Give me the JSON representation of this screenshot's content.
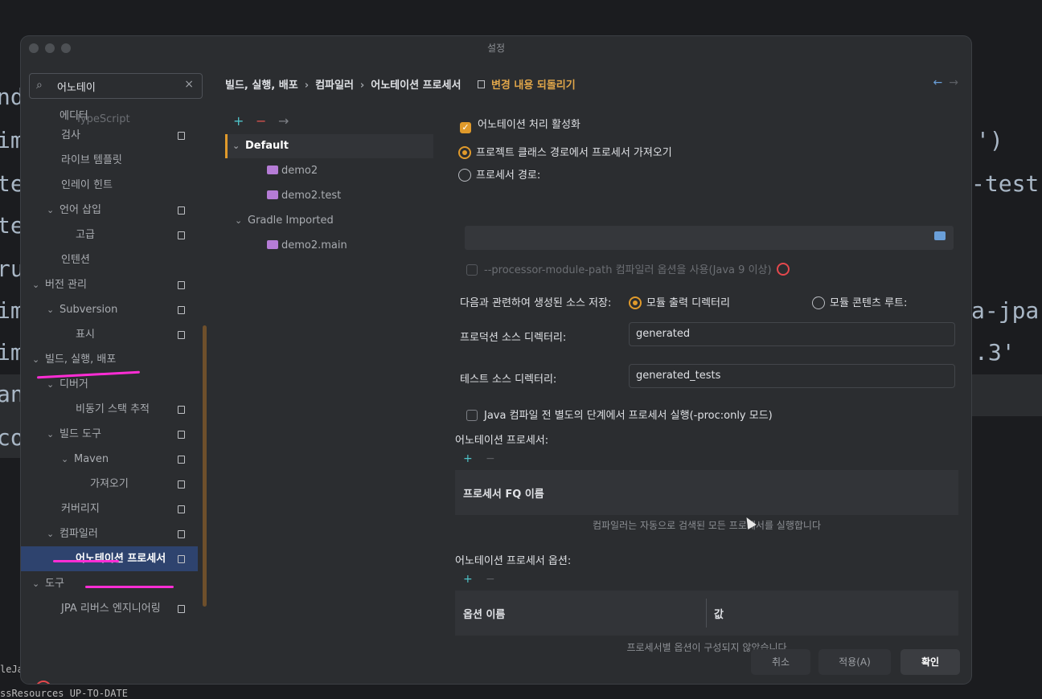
{
  "background": {
    "code_lines": [
      "nd",
      "im",
      "te",
      "te",
      "ru",
      "im",
      "im",
      "an",
      "co"
    ],
    "right_fragments": [
      "')",
      "-test",
      "a-jpa",
      ".3'"
    ],
    "console_lines": [
      "leJa",
      "ssResources UP-TO-DATE"
    ]
  },
  "dialog": {
    "title": "설정",
    "search": {
      "value": "어노테이 ",
      "clear_icon": "×"
    },
    "tree": [
      {
        "label": "에디터",
        "chev": "",
        "badge": false
      },
      {
        "label": "TypeScript",
        "chev": "",
        "badge": false
      },
      {
        "label": "검사",
        "chev": "",
        "badge": true
      },
      {
        "label": "라이브 템플릿",
        "chev": "",
        "badge": false
      },
      {
        "label": "인레이 힌트",
        "chev": "",
        "badge": false
      },
      {
        "label": "언어 삽입",
        "chev": "⌄",
        "badge": true
      },
      {
        "label": "고급",
        "chev": "",
        "badge": true
      },
      {
        "label": "인텐션",
        "chev": "",
        "badge": false
      },
      {
        "label": "버전 관리",
        "chev": "⌄",
        "badge": true
      },
      {
        "label": "Subversion",
        "chev": "⌄",
        "badge": true
      },
      {
        "label": "표시",
        "chev": "",
        "badge": true
      },
      {
        "label": "빌드, 실행, 배포",
        "chev": "⌄",
        "badge": false
      },
      {
        "label": "디버거",
        "chev": "⌄",
        "badge": false
      },
      {
        "label": "비동기 스택 추적",
        "chev": "",
        "badge": true
      },
      {
        "label": "빌드 도구",
        "chev": "⌄",
        "badge": true
      },
      {
        "label": "Maven",
        "chev": "⌄",
        "badge": true
      },
      {
        "label": "가져오기",
        "chev": "",
        "badge": true
      },
      {
        "label": "커버리지",
        "chev": "",
        "badge": true
      },
      {
        "label": "컴파일러",
        "chev": "⌄",
        "badge": true
      },
      {
        "label": "어노테이션 프로세서",
        "chev": "",
        "badge": true
      },
      {
        "label": "도구",
        "chev": "⌄",
        "badge": false
      },
      {
        "label": "JPA 리버스 엔지니어링",
        "chev": "",
        "badge": true
      }
    ],
    "breadcrumb": [
      "빌드, 실행, 배포",
      "컴파일러",
      "어노테이션 프로세서"
    ],
    "breadcrumb_sep": "›",
    "revert_label": "변경 내용 되돌리기",
    "nav_back": "←",
    "nav_forward": "→",
    "profiles_toolbar": {
      "add": "+",
      "remove": "−",
      "move": "→"
    },
    "profiles": [
      {
        "label": "Default",
        "chev": "⌄"
      },
      {
        "label": "demo2",
        "chev": ""
      },
      {
        "label": "demo2.test",
        "chev": ""
      },
      {
        "label": "Gradle Imported",
        "chev": "⌄"
      },
      {
        "label": "demo2.main",
        "chev": ""
      }
    ],
    "settings": {
      "enable_processing": "어노테이션 처리 활성화",
      "obtain_from_classpath": "프로젝트 클래스 경로에서 프로세서 가져오기",
      "processor_path": "프로세서 경로:",
      "module_path_option": "--processor-module-path 컴파일러 옵션을 사용(Java 9 이상)",
      "store_relative_label": "다음과 관련하여 생성된 소스 저장:",
      "store_module_output": "모듈 출력 디렉터리",
      "store_content_root": "모듈 콘텐츠 루트:",
      "prod_dir_label": "프로덕션 소스 디렉터리:",
      "prod_dir_value": "generated",
      "test_dir_label": "테스트 소스 디렉터리:",
      "test_dir_value": "generated_tests",
      "proc_only": "Java 컴파일 전 별도의 단계에서 프로세서 실행(-proc:only 모드)",
      "processors_label": "어노테이션 프로세서:",
      "processors_col": "프로세서 FQ 이름",
      "processors_empty": "컴파일러는 자동으로 검색된 모든 프로세서를 실행합니다",
      "options_label": "어노테이션 프로세서 옵션:",
      "options_col_name": "옵션 이름",
      "options_col_value": "값",
      "options_empty": "프로세서별 옵션이 구성되지 않았습니다",
      "add": "+",
      "remove": "−"
    },
    "buttons": {
      "cancel": "취소",
      "apply": "적용(A)",
      "ok": "확인"
    },
    "help": "?"
  },
  "colors": {
    "accent": "#e09a2b",
    "annotation_marker": "#ff2dd5",
    "selection": "#2e436e"
  }
}
